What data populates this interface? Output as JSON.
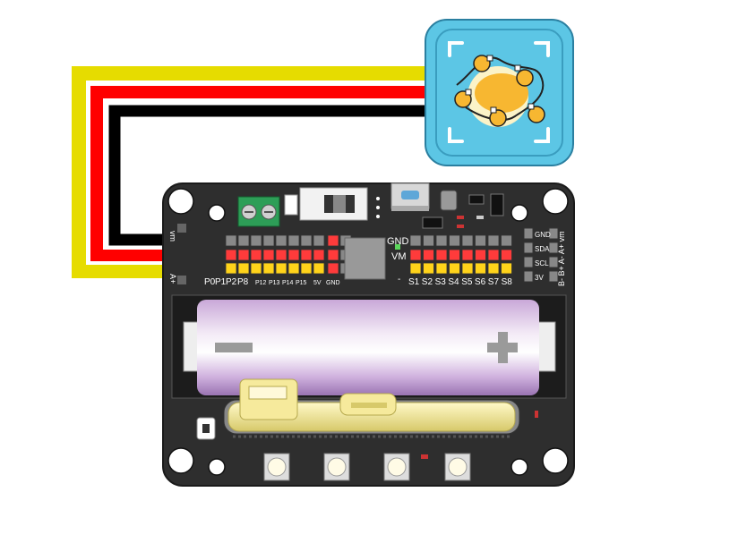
{
  "board": {
    "gnd_label": "GND",
    "vm_label": "VM",
    "left_pin_labels": [
      "P0",
      "P1",
      "P2",
      "P8",
      "P12",
      "P13",
      "P14",
      "P15",
      "5V",
      "GND"
    ],
    "servo_labels": [
      "S1",
      "S2",
      "S3",
      "S4",
      "S5",
      "S6",
      "S7",
      "S8"
    ],
    "i2c_labels": [
      "GND",
      "SDA",
      "SCL",
      "3V"
    ],
    "motor_side_labels": [
      "B-",
      "B+",
      "A-",
      "A+",
      "vm"
    ],
    "left_edge_top": "vm",
    "left_edge_bottom": "A+",
    "minus_sign": "-"
  },
  "module": {
    "icon_name": "led-light-string-icon",
    "frame_color": "#5cc6e5"
  },
  "wires": {
    "colors": {
      "signal": "#e6dc00",
      "power": "#ff0000",
      "ground": "#000000"
    }
  }
}
